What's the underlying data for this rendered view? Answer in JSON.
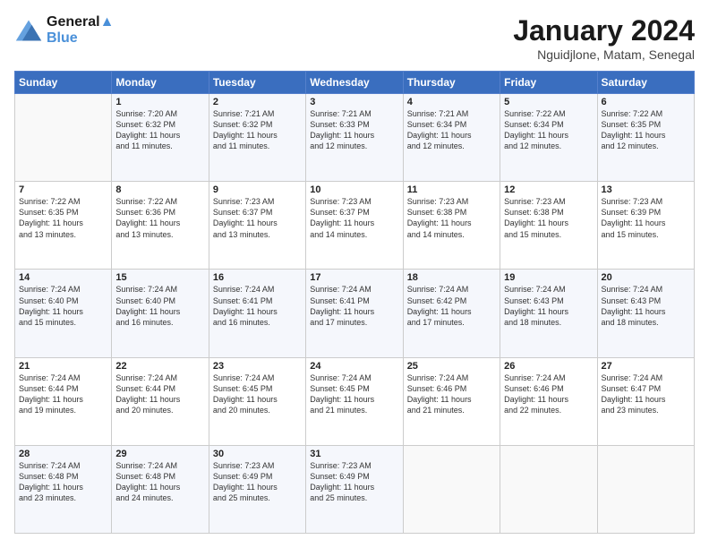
{
  "header": {
    "logo_line1": "General",
    "logo_line2": "Blue",
    "month": "January 2024",
    "location": "Nguidjlone, Matam, Senegal"
  },
  "days_of_week": [
    "Sunday",
    "Monday",
    "Tuesday",
    "Wednesday",
    "Thursday",
    "Friday",
    "Saturday"
  ],
  "weeks": [
    [
      {
        "day": "",
        "info": ""
      },
      {
        "day": "1",
        "info": "Sunrise: 7:20 AM\nSunset: 6:32 PM\nDaylight: 11 hours\nand 11 minutes."
      },
      {
        "day": "2",
        "info": "Sunrise: 7:21 AM\nSunset: 6:32 PM\nDaylight: 11 hours\nand 11 minutes."
      },
      {
        "day": "3",
        "info": "Sunrise: 7:21 AM\nSunset: 6:33 PM\nDaylight: 11 hours\nand 12 minutes."
      },
      {
        "day": "4",
        "info": "Sunrise: 7:21 AM\nSunset: 6:34 PM\nDaylight: 11 hours\nand 12 minutes."
      },
      {
        "day": "5",
        "info": "Sunrise: 7:22 AM\nSunset: 6:34 PM\nDaylight: 11 hours\nand 12 minutes."
      },
      {
        "day": "6",
        "info": "Sunrise: 7:22 AM\nSunset: 6:35 PM\nDaylight: 11 hours\nand 12 minutes."
      }
    ],
    [
      {
        "day": "7",
        "info": "Sunrise: 7:22 AM\nSunset: 6:35 PM\nDaylight: 11 hours\nand 13 minutes."
      },
      {
        "day": "8",
        "info": "Sunrise: 7:22 AM\nSunset: 6:36 PM\nDaylight: 11 hours\nand 13 minutes."
      },
      {
        "day": "9",
        "info": "Sunrise: 7:23 AM\nSunset: 6:37 PM\nDaylight: 11 hours\nand 13 minutes."
      },
      {
        "day": "10",
        "info": "Sunrise: 7:23 AM\nSunset: 6:37 PM\nDaylight: 11 hours\nand 14 minutes."
      },
      {
        "day": "11",
        "info": "Sunrise: 7:23 AM\nSunset: 6:38 PM\nDaylight: 11 hours\nand 14 minutes."
      },
      {
        "day": "12",
        "info": "Sunrise: 7:23 AM\nSunset: 6:38 PM\nDaylight: 11 hours\nand 15 minutes."
      },
      {
        "day": "13",
        "info": "Sunrise: 7:23 AM\nSunset: 6:39 PM\nDaylight: 11 hours\nand 15 minutes."
      }
    ],
    [
      {
        "day": "14",
        "info": "Sunrise: 7:24 AM\nSunset: 6:40 PM\nDaylight: 11 hours\nand 15 minutes."
      },
      {
        "day": "15",
        "info": "Sunrise: 7:24 AM\nSunset: 6:40 PM\nDaylight: 11 hours\nand 16 minutes."
      },
      {
        "day": "16",
        "info": "Sunrise: 7:24 AM\nSunset: 6:41 PM\nDaylight: 11 hours\nand 16 minutes."
      },
      {
        "day": "17",
        "info": "Sunrise: 7:24 AM\nSunset: 6:41 PM\nDaylight: 11 hours\nand 17 minutes."
      },
      {
        "day": "18",
        "info": "Sunrise: 7:24 AM\nSunset: 6:42 PM\nDaylight: 11 hours\nand 17 minutes."
      },
      {
        "day": "19",
        "info": "Sunrise: 7:24 AM\nSunset: 6:43 PM\nDaylight: 11 hours\nand 18 minutes."
      },
      {
        "day": "20",
        "info": "Sunrise: 7:24 AM\nSunset: 6:43 PM\nDaylight: 11 hours\nand 18 minutes."
      }
    ],
    [
      {
        "day": "21",
        "info": "Sunrise: 7:24 AM\nSunset: 6:44 PM\nDaylight: 11 hours\nand 19 minutes."
      },
      {
        "day": "22",
        "info": "Sunrise: 7:24 AM\nSunset: 6:44 PM\nDaylight: 11 hours\nand 20 minutes."
      },
      {
        "day": "23",
        "info": "Sunrise: 7:24 AM\nSunset: 6:45 PM\nDaylight: 11 hours\nand 20 minutes."
      },
      {
        "day": "24",
        "info": "Sunrise: 7:24 AM\nSunset: 6:45 PM\nDaylight: 11 hours\nand 21 minutes."
      },
      {
        "day": "25",
        "info": "Sunrise: 7:24 AM\nSunset: 6:46 PM\nDaylight: 11 hours\nand 21 minutes."
      },
      {
        "day": "26",
        "info": "Sunrise: 7:24 AM\nSunset: 6:46 PM\nDaylight: 11 hours\nand 22 minutes."
      },
      {
        "day": "27",
        "info": "Sunrise: 7:24 AM\nSunset: 6:47 PM\nDaylight: 11 hours\nand 23 minutes."
      }
    ],
    [
      {
        "day": "28",
        "info": "Sunrise: 7:24 AM\nSunset: 6:48 PM\nDaylight: 11 hours\nand 23 minutes."
      },
      {
        "day": "29",
        "info": "Sunrise: 7:24 AM\nSunset: 6:48 PM\nDaylight: 11 hours\nand 24 minutes."
      },
      {
        "day": "30",
        "info": "Sunrise: 7:23 AM\nSunset: 6:49 PM\nDaylight: 11 hours\nand 25 minutes."
      },
      {
        "day": "31",
        "info": "Sunrise: 7:23 AM\nSunset: 6:49 PM\nDaylight: 11 hours\nand 25 minutes."
      },
      {
        "day": "",
        "info": ""
      },
      {
        "day": "",
        "info": ""
      },
      {
        "day": "",
        "info": ""
      }
    ]
  ]
}
